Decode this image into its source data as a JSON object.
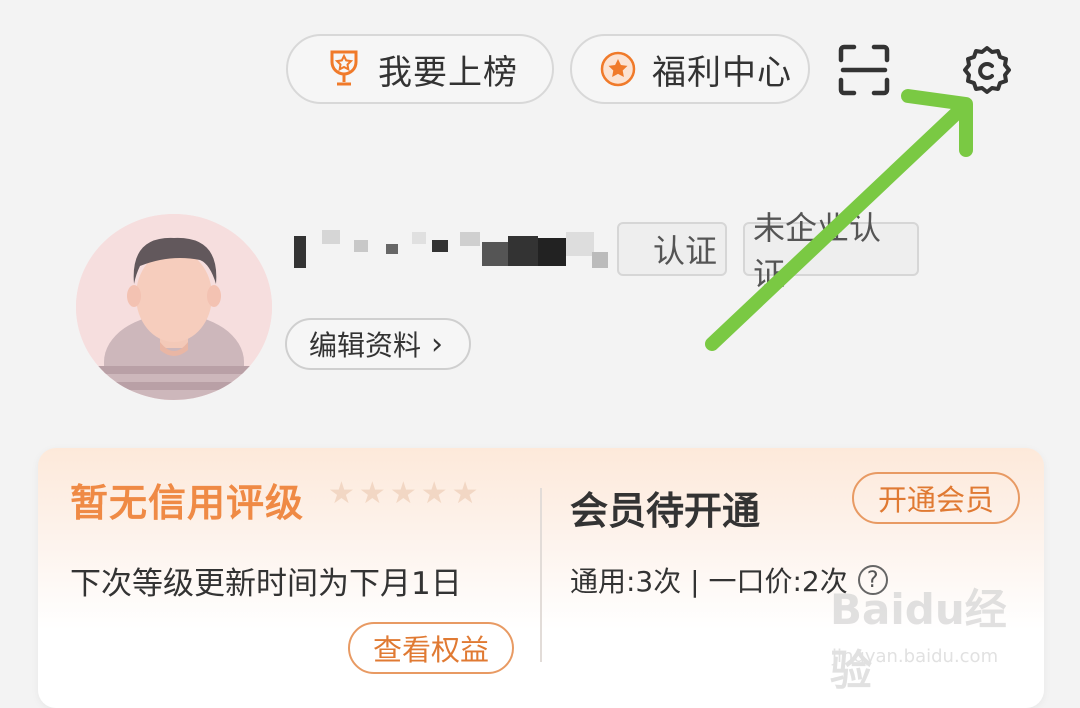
{
  "header": {
    "rank_label": "我要上榜",
    "welfare_label": "福利中心",
    "scan_icon": "scan-icon",
    "settings_icon": "settings-gear-icon"
  },
  "profile": {
    "verify_personal": "认证",
    "verify_enterprise": "未企业认证",
    "edit_label": "编辑资料",
    "edit_chevron": "›"
  },
  "credit": {
    "title": "暂无信用评级",
    "stars_total": 5,
    "subtitle": "下次等级更新时间为下月1日",
    "benefits_label": "查看权益"
  },
  "membership": {
    "title": "会员待开通",
    "open_label": "开通会员",
    "usage": "通用:3次 | 一口价:2次",
    "help_glyph": "?"
  },
  "watermark": {
    "main": "Bai",
    "paw": "du",
    "suffix": "经验",
    "url": "jingyan.baidu.com"
  },
  "colors": {
    "accent": "#ef8a45",
    "arrow": "#7ac943"
  }
}
